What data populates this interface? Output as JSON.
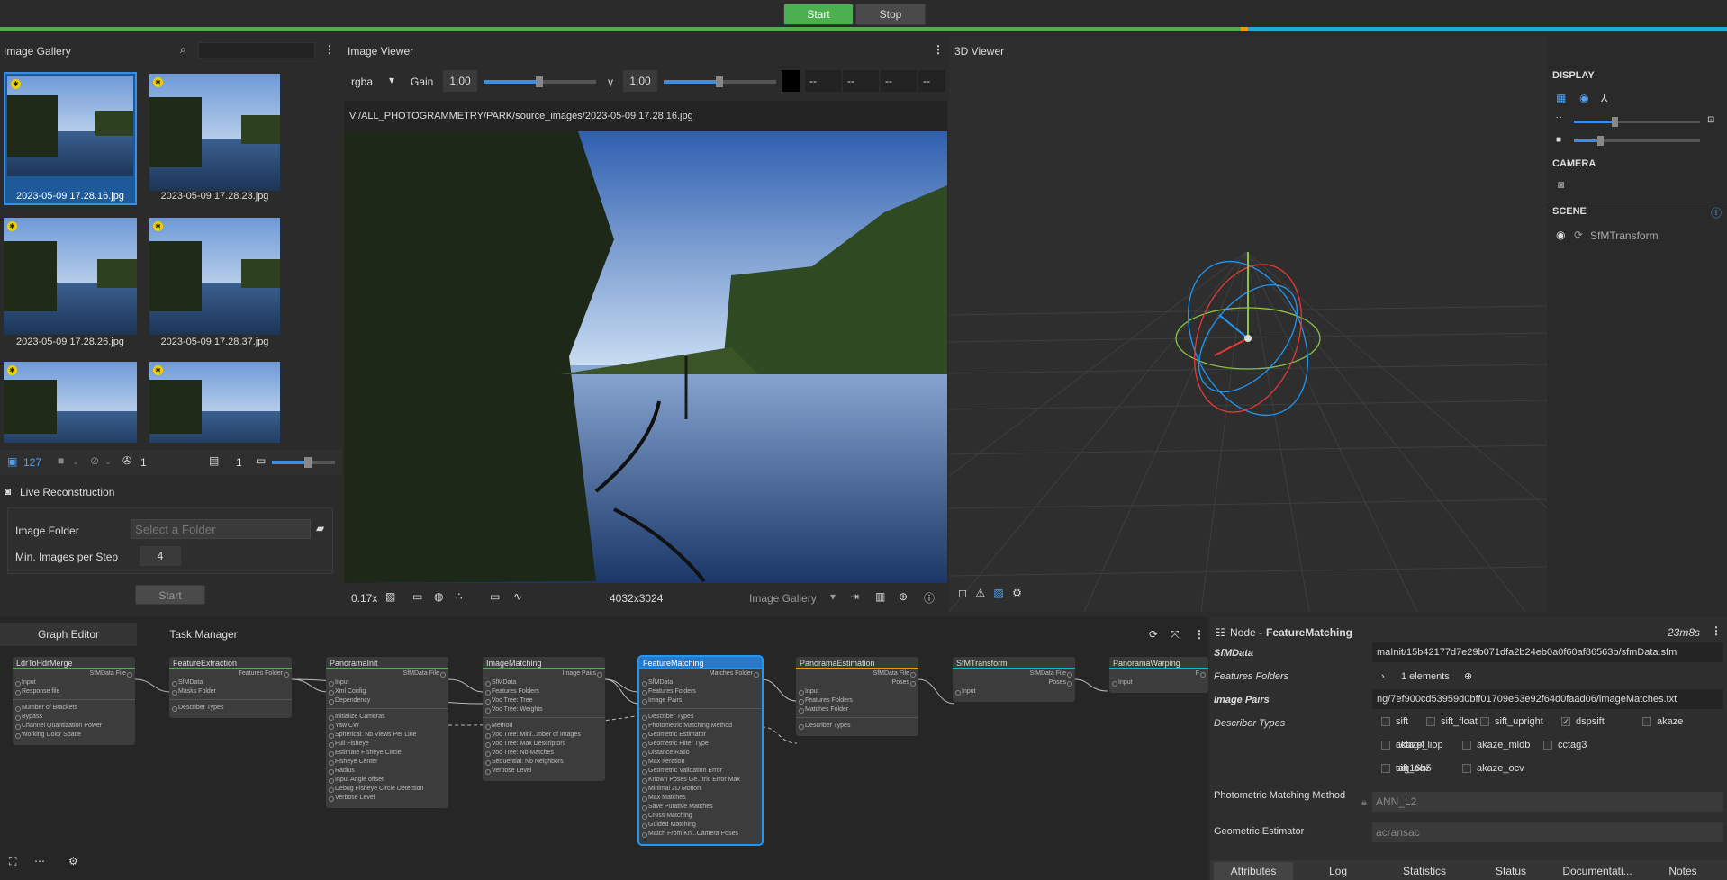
{
  "toolbar": {
    "start": "Start",
    "stop": "Stop"
  },
  "gallery": {
    "title": "Image Gallery",
    "search_placeholder": "",
    "images": [
      {
        "name": "2023-05-09 17.28.16.jpg"
      },
      {
        "name": "2023-05-09 17.28.23.jpg"
      },
      {
        "name": "2023-05-09 17.28.26.jpg"
      },
      {
        "name": "2023-05-09 17.28.37.jpg"
      },
      {
        "name": ""
      },
      {
        "name": ""
      }
    ],
    "count_images": "127",
    "count_cameras": "-",
    "count_other": "-",
    "count_rec": "1",
    "count_intrinsics": "1"
  },
  "live": {
    "title": "Live Reconstruction",
    "folder_label": "Image Folder",
    "folder_placeholder": "Select a Folder",
    "min_label": "Min. Images per Step",
    "min_value": "4",
    "start": "Start"
  },
  "viewer": {
    "title": "Image Viewer",
    "channel": "rgba",
    "gain_label": "Gain",
    "gain_value": "1.00",
    "gamma_label": "γ",
    "gamma_value": "1.00",
    "rgba": [
      "--",
      "--",
      "--",
      "--"
    ],
    "path": "V:/ALL_PHOTOGRAMMETRY/PARK/source_images/2023-05-09 17.28.16.jpg",
    "zoom": "0.17x",
    "resolution": "4032x3024",
    "source": "Image Gallery"
  },
  "viewer3d": {
    "title": "3D Viewer",
    "display": "DISPLAY",
    "camera": "CAMERA",
    "scene": "SCENE",
    "scene_item": "SfMTransform"
  },
  "graph": {
    "tab_graph": "Graph Editor",
    "tab_tasks": "Task Manager"
  },
  "nodes": [
    {
      "name": "LdrToHdrMerge",
      "color": "#4caf50",
      "outs": [
        "SfMData File"
      ],
      "ins": [
        "Input",
        "Response file"
      ],
      "params": [
        "Number of Brackets",
        "Bypass",
        "Channel Quantization Power",
        "Working Color Space"
      ]
    },
    {
      "name": "FeatureExtraction",
      "color": "#4caf50",
      "outs": [
        "Features Folder"
      ],
      "ins": [
        "SfMData",
        "Masks Folder"
      ],
      "params": [
        "Describer Types"
      ]
    },
    {
      "name": "PanoramaInit",
      "color": "#4caf50",
      "outs": [
        "SfMData File"
      ],
      "ins": [
        "Input",
        "Xml Config",
        "Dependency"
      ],
      "params": [
        "Initialize Cameras",
        "Yaw CW",
        "Spherical: Nb Views Per Line",
        "Full Fisheye",
        "Estimate Fisheye Circle",
        "Fisheye Center",
        "Radius",
        "Input Angle offset",
        "Debug Fisheye Circle Detection",
        "Verbose Level"
      ]
    },
    {
      "name": "ImageMatching",
      "color": "#4caf50",
      "outs": [
        "Image Pairs"
      ],
      "ins": [
        "SfMData",
        "Features Folders",
        "Voc Tree: Tree",
        "Voc Tree: Weights"
      ],
      "params": [
        "Method",
        "Voc Tree: Mini...mber of Images",
        "Voc Tree: Max Descriptors",
        "Voc Tree: Nb Matches",
        "Sequential: Nb Neighbors",
        "Verbose Level"
      ]
    },
    {
      "name": "FeatureMatching",
      "color": "#2196f3",
      "outs": [
        "Matches Folder"
      ],
      "ins": [
        "SfMData",
        "Features Folders",
        "Image Pairs"
      ],
      "params": [
        "Describer Types",
        "Photometric Matching Method",
        "Geometric Estimator",
        "Geometric Filter Type",
        "Distance Ratio",
        "Max Iteration",
        "Geometric Validation Error",
        "Known Poses Ge...tric Error Max",
        "Minimal 2D Motion",
        "Max Matches",
        "Save Putative Matches",
        "Cross Matching",
        "Guided Matching",
        "Match From Kn...Camera Poses"
      ]
    },
    {
      "name": "PanoramaEstimation",
      "color": "#ff9800",
      "outs": [
        "SfMData File",
        "Poses"
      ],
      "ins": [
        "Input",
        "Features Folders",
        "Matches Folder"
      ],
      "params": [
        "Describer Types"
      ]
    },
    {
      "name": "SfMTransform",
      "color": "#00bcd4",
      "outs": [
        "SfMData File",
        "Poses"
      ],
      "ins": [
        "Input"
      ],
      "params": []
    },
    {
      "name": "PanoramaWarping",
      "color": "#00bcd4",
      "outs": [
        "F"
      ],
      "ins": [
        "Input"
      ],
      "params": []
    }
  ],
  "inspector": {
    "title_prefix": "Node - ",
    "title": "FeatureMatching",
    "time": "23m8s",
    "sfm_label": "SfMData",
    "sfm_value": "maInit/15b42177d7e29b071dfa2b24eb0a0f60af86563b/sfmData.sfm",
    "ff_label": "Features Folders",
    "ff_value": "1 elements",
    "ip_label": "Image Pairs",
    "ip_value": "ng/7ef900cd53959d0bff01709e53e92f64d0faad06/imageMatches.txt",
    "dt_label": "Describer Types",
    "describers": [
      {
        "n": "sift",
        "c": false
      },
      {
        "n": "sift_float",
        "c": false
      },
      {
        "n": "sift_upright",
        "c": false
      },
      {
        "n": "dspsift",
        "c": true
      },
      {
        "n": "akaze",
        "c": false
      },
      {
        "n": "akaze_liop",
        "c": false
      },
      {
        "n": "akaze_mldb",
        "c": false
      },
      {
        "n": "cctag3",
        "c": false
      },
      {
        "n": "cctag4",
        "c": false
      },
      {
        "n": "sift_ocv",
        "c": false
      },
      {
        "n": "akaze_ocv",
        "c": false
      },
      {
        "n": "tag16h5",
        "c": false
      }
    ],
    "pm_label": "Photometric Matching Method",
    "pm_value": "ANN_L2",
    "ge_label": "Geometric Estimator",
    "ge_value": "acransac",
    "tabs": [
      "Attributes",
      "Log",
      "Statistics",
      "Status",
      "Documentati...",
      "Notes"
    ]
  }
}
